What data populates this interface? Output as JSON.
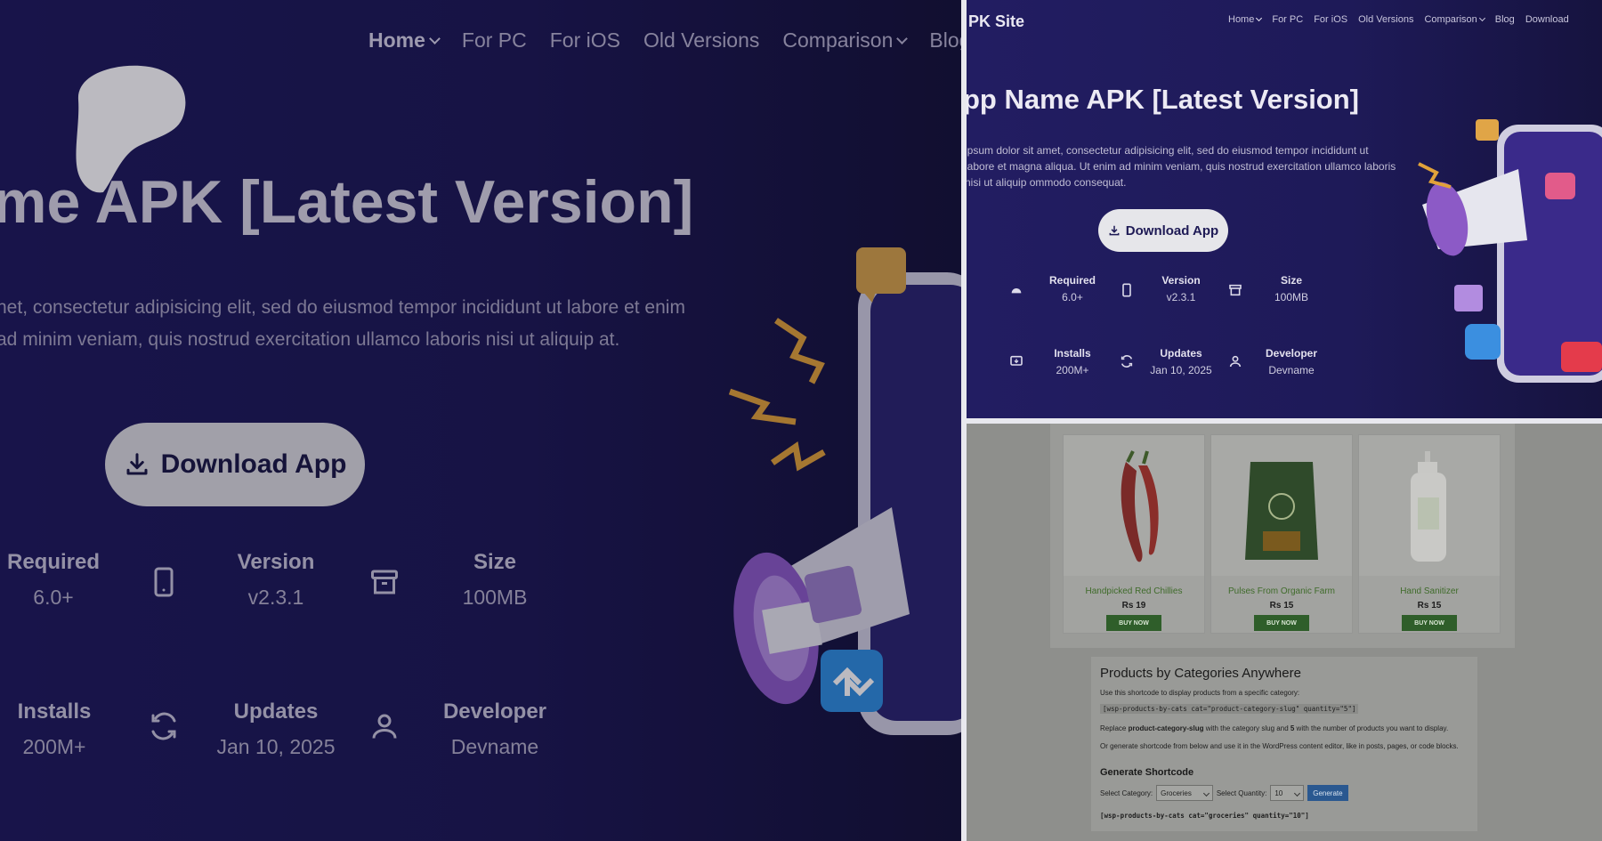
{
  "nav": {
    "items": [
      {
        "label": "Home",
        "dropdown": true
      },
      {
        "label": "For PC"
      },
      {
        "label": "For iOS"
      },
      {
        "label": "Old Versions"
      },
      {
        "label": "Comparison",
        "dropdown": true
      },
      {
        "label": "Blog"
      }
    ]
  },
  "hero": {
    "title_left": "me APK [Latest Version]",
    "desc_left": "net, consectetur adipisicing elit, sed do eiusmod tempor incididunt ut labore et enim ad minim veniam, quis nostrud exercitation ullamco laboris nisi ut aliquip at.",
    "download_label": "Download App"
  },
  "stats": [
    {
      "key": "Required",
      "value": "6.0+",
      "icon": "android-icon"
    },
    {
      "key": "Version",
      "value": "v2.3.1",
      "icon": "phone-icon"
    },
    {
      "key": "Size",
      "value": "100MB",
      "icon": "archive-icon"
    },
    {
      "key": "Installs",
      "value": "200M+",
      "icon": "install-icon"
    },
    {
      "key": "Updates",
      "value": "Jan 10, 2025",
      "icon": "refresh-icon"
    },
    {
      "key": "Developer",
      "value": "Devname",
      "icon": "user-icon"
    }
  ],
  "right_top": {
    "brand": "PK Site",
    "nav": [
      {
        "label": "Home",
        "dropdown": true
      },
      {
        "label": "For PC"
      },
      {
        "label": "For iOS"
      },
      {
        "label": "Old Versions"
      },
      {
        "label": "Comparison",
        "dropdown": true
      },
      {
        "label": "Blog"
      },
      {
        "label": "Download"
      }
    ],
    "title": "pp Name APK [Latest Version]",
    "desc": "ipsum dolor sit amet, consectetur adipisicing elit, sed do eiusmod tempor incididunt ut labore et magna aliqua. Ut enim ad minim veniam, quis nostrud exercitation ullamco laboris nisi ut aliquip ommodo consequat.",
    "download_label": "Download App"
  },
  "products": [
    {
      "name": "Handpicked Red Chillies",
      "price": "Rs 19",
      "button": "BUY NOW"
    },
    {
      "name": "Pulses From Organic Farm",
      "price": "Rs 15",
      "button": "BUY NOW"
    },
    {
      "name": "Hand Sanitizer",
      "price": "Rs 15",
      "button": "BUY NOW"
    }
  ],
  "shortcode_box": {
    "title": "Products by Categories Anywhere",
    "line1": "Use this shortcode to display products from a specific category:",
    "code": "[wsp-products-by-cats cat=\"product-category-slug\" quantity=\"5\"]",
    "line2_pre": "Replace ",
    "line2_bold": "product-category-slug",
    "line2_mid": " with the category slug and ",
    "line2_bold2": "5",
    "line2_post": " with the number of products you want to display.",
    "line3": "Or generate shortcode from below and use it in the WordPress content editor, like in posts, pages, or code blocks.",
    "generate_heading": "Generate Shortcode",
    "select_category_label": "Select Category:",
    "category_value": "Groceries",
    "select_quantity_label": "Select Quantity:",
    "quantity_value": "10",
    "generate_button": "Generate",
    "output": "[wsp-products-by-cats cat=\"groceries\" quantity=\"10\"]"
  }
}
